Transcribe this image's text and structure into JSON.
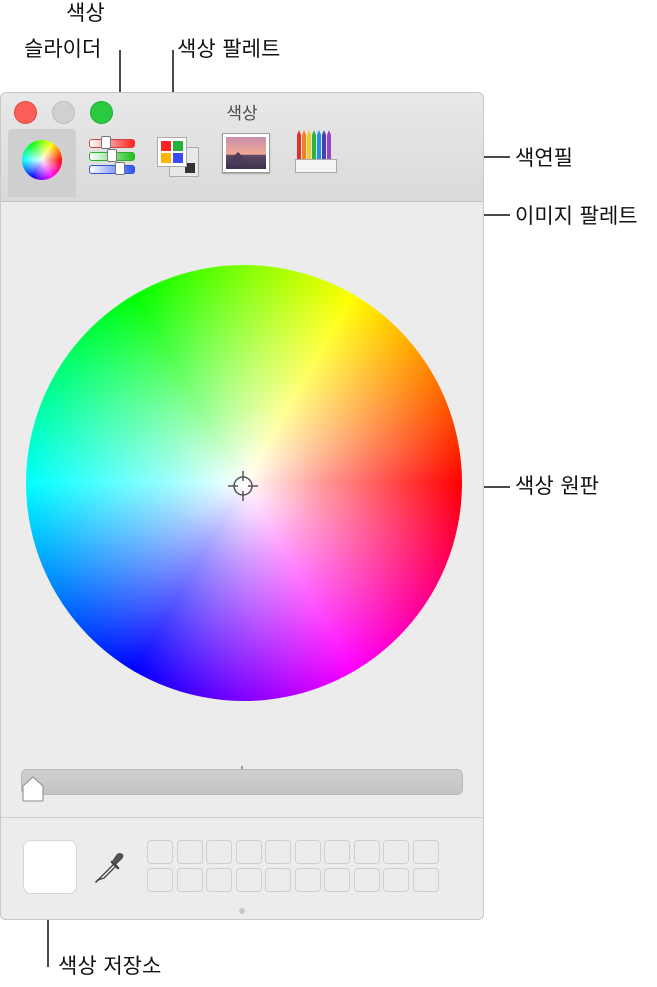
{
  "window": {
    "title": "색상"
  },
  "callouts": {
    "sliders_line1": "색상",
    "sliders_line2": "슬라이더",
    "palettes": "색상 팔레트",
    "pencils": "색연필",
    "image_palettes": "이미지 팔레트",
    "color_wheel": "색상 원판",
    "swatches": "색상 저장소"
  },
  "toolbar": {
    "tools": [
      "color-wheel-tool-icon",
      "color-sliders-tool-icon",
      "color-palettes-tool-icon",
      "image-palettes-tool-icon",
      "pencils-tool-icon"
    ],
    "selected": "color-wheel-tool-icon"
  },
  "colors": {
    "close": "#fc5f57",
    "minimize": "#d0d0d0",
    "zoom": "#2ac940",
    "current_color": "#ffffff"
  },
  "brightness": {
    "level": 0.0
  }
}
